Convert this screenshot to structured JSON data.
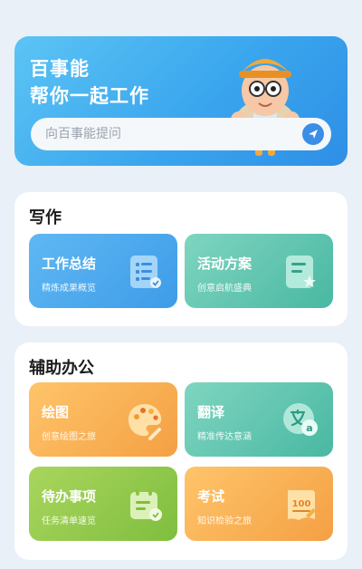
{
  "hero": {
    "title_line1": "百事能",
    "title_line2": "帮你一起工作",
    "search_placeholder": "向百事能提问",
    "send_icon": "send-icon"
  },
  "sections": {
    "writing": {
      "title": "写作",
      "cards": [
        {
          "title": "工作总结",
          "subtitle": "精炼成果概览",
          "icon": "document-list-icon"
        },
        {
          "title": "活动方案",
          "subtitle": "创意启航盛典",
          "icon": "document-star-icon"
        }
      ]
    },
    "office": {
      "title": "辅助办公",
      "cards": [
        {
          "title": "绘图",
          "subtitle": "创意绘图之旅",
          "icon": "palette-icon"
        },
        {
          "title": "翻译",
          "subtitle": "精准传达意涵",
          "icon": "translate-icon"
        },
        {
          "title": "待办事项",
          "subtitle": "任务清单速览",
          "icon": "todo-icon"
        },
        {
          "title": "考试",
          "subtitle": "知识检验之旅",
          "icon": "exam-paper-icon"
        }
      ]
    }
  },
  "colors": {
    "hero": "#3aa6ee",
    "blue_card": "#4aa8ee",
    "teal_card": "#5cc3ad",
    "orange_card": "#f8ae52",
    "green_card": "#93c94a"
  }
}
